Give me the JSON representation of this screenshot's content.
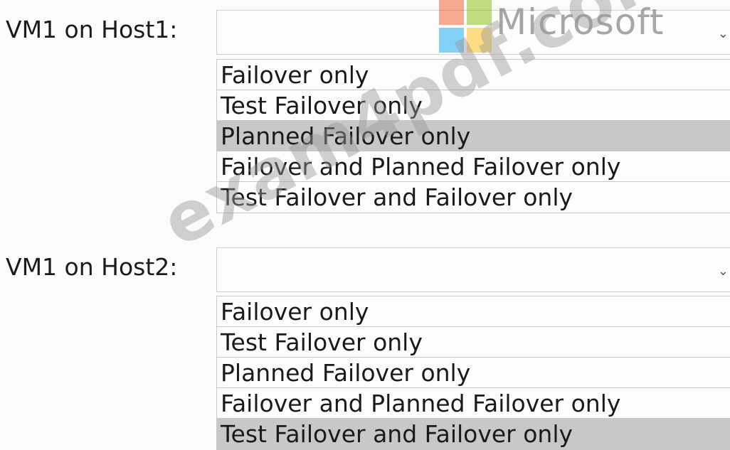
{
  "branding": {
    "logo_word": "Microsoft",
    "logo_colors": [
      "#f25022",
      "#7fba00",
      "#00a4ef",
      "#ffb900"
    ],
    "watermark": "exam4pdf.com"
  },
  "questions": [
    {
      "label": "VM1 on Host1:",
      "selected_value": "",
      "chevron_icon": "chevron-down-icon",
      "options": [
        "Failover only",
        "Test Failover only",
        "Planned Failover only",
        "Failover and Planned Failover only",
        "Test Failover and Failover only"
      ],
      "highlighted_option": "Planned Failover only"
    },
    {
      "label": "VM1 on Host2:",
      "selected_value": "",
      "chevron_icon": "chevron-down-icon",
      "options": [
        "Failover only",
        "Test Failover only",
        "Planned Failover only",
        "Failover and Planned Failover only",
        "Test Failover and Failover only"
      ],
      "highlighted_option": "Test Failover and Failover only"
    }
  ],
  "colors": {
    "highlight": "#c8c8c8",
    "border": "#c8c8c8"
  }
}
